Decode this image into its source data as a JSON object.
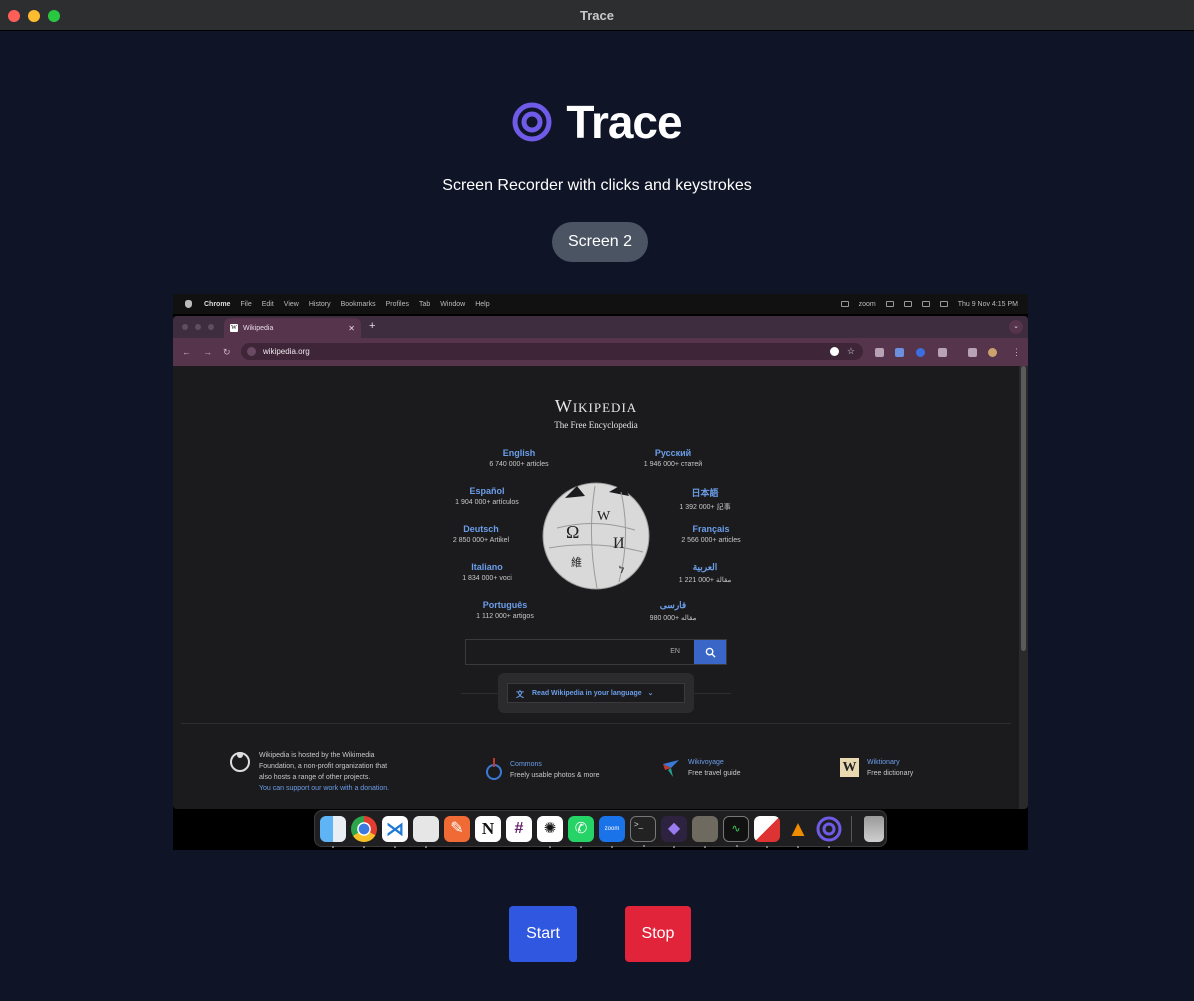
{
  "window": {
    "title": "Trace"
  },
  "app": {
    "name": "Trace",
    "subtitle": "Screen Recorder with clicks and keystrokes",
    "screen_selector": "Screen 2",
    "start_label": "Start",
    "stop_label": "Stop",
    "colors": {
      "background": "#0f1527",
      "accent": "#6f5be8",
      "start": "#3057e0",
      "stop": "#e12439"
    }
  },
  "preview": {
    "menubar": {
      "items": [
        "Chrome",
        "File",
        "Edit",
        "View",
        "History",
        "Bookmarks",
        "Profiles",
        "Tab",
        "Window",
        "Help"
      ],
      "zoom_label": "zoom",
      "clock": "Thu 9 Nov  4:15 PM"
    },
    "browser": {
      "tab_title": "Wikipedia",
      "url": "wikipedia.org"
    },
    "wikipedia": {
      "wordmark": "Wikipedia",
      "tagline": "The Free Encyclopedia",
      "languages": [
        {
          "name": "English",
          "count": "6 740 000+ articles"
        },
        {
          "name": "Русский",
          "count": "1 946 000+ статей"
        },
        {
          "name": "Español",
          "count": "1 904 000+ artículos"
        },
        {
          "name": "日本語",
          "count": "1 392 000+ 記事"
        },
        {
          "name": "Deutsch",
          "count": "2 850 000+ Artikel"
        },
        {
          "name": "Français",
          "count": "2 566 000+ articles"
        },
        {
          "name": "Italiano",
          "count": "1 834 000+ voci"
        },
        {
          "name": "العربية",
          "count": "1 221 000+ مقالة"
        },
        {
          "name": "Português",
          "count": "1 112 000+ artigos"
        },
        {
          "name": "فارسی",
          "count": "980 000+ مقاله"
        }
      ],
      "search_lang": "EN",
      "read_language_label": "Read Wikipedia in your language",
      "footer": {
        "hosted_lines": [
          "Wikipedia is hosted by the Wikimedia",
          "Foundation, a non-profit organization that",
          "also hosts a range of other projects."
        ],
        "support_link": "You can support our work with a donation.",
        "projects": [
          {
            "title": "Commons",
            "desc": "Freely usable photos & more"
          },
          {
            "title": "Wikivoyage",
            "desc": "Free travel guide"
          },
          {
            "title": "Wiktionary",
            "desc": "Free dictionary"
          }
        ]
      }
    },
    "dock_apps": [
      "finder-icon",
      "chrome-icon",
      "vscode-icon",
      "preview-icon",
      "pencil-app-icon",
      "notion-icon",
      "slack-icon",
      "chatgpt-icon",
      "whatsapp-icon",
      "zoom-icon",
      "terminal-icon",
      "obsidian-icon",
      "gimp-icon",
      "activity-monitor-icon",
      "screenshot-app-icon",
      "vlc-icon",
      "trace-icon",
      "trash-icon"
    ],
    "dock_zoom_label": "zoom"
  }
}
